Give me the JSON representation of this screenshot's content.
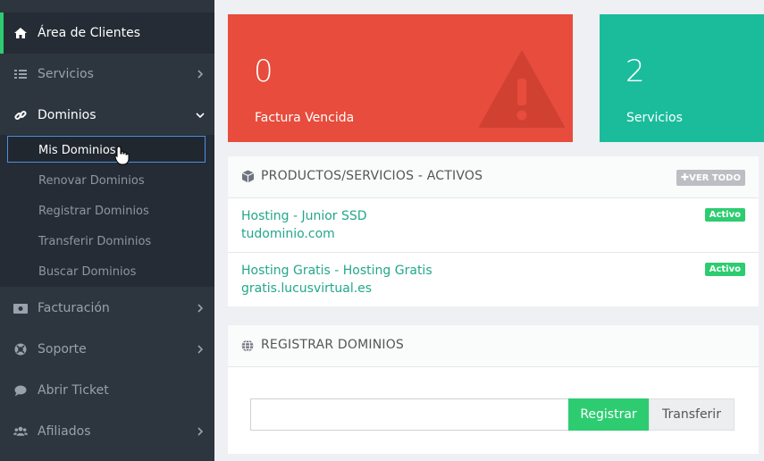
{
  "sidebar": {
    "items": [
      {
        "label": "Área de Clientes",
        "icon": "home-icon"
      },
      {
        "label": "Servicios",
        "icon": "list-icon"
      },
      {
        "label": "Dominios",
        "icon": "link-icon"
      },
      {
        "label": "Facturación",
        "icon": "money-icon"
      },
      {
        "label": "Soporte",
        "icon": "lifebuoy-icon"
      },
      {
        "label": "Abrir Ticket",
        "icon": "comment-icon"
      },
      {
        "label": "Afiliados",
        "icon": "users-icon"
      }
    ],
    "submenu": [
      {
        "label": "Mis Dominios"
      },
      {
        "label": "Renovar Dominios"
      },
      {
        "label": "Registrar Dominios"
      },
      {
        "label": "Transferir Dominios"
      },
      {
        "label": "Buscar Dominios"
      }
    ]
  },
  "stats": [
    {
      "value": "0",
      "label": "Factura Vencida",
      "color": "#e74c3c",
      "icon": "warning-icon"
    },
    {
      "value": "2",
      "label": "Servicios",
      "color": "#1abc9c"
    }
  ],
  "products_panel": {
    "title": "PRODUCTOS/SERVICIOS - ACTIVOS",
    "view_all": "VER TODO",
    "rows": [
      {
        "name": "Hosting - Junior SSD",
        "domain": "tudominio.com",
        "status": "Activo"
      },
      {
        "name": "Hosting Gratis - Hosting Gratis",
        "domain": "gratis.lucusvirtual.es",
        "status": "Activo"
      }
    ]
  },
  "domains_panel": {
    "title": "REGISTRAR DOMINIOS",
    "input_value": "",
    "register_label": "Registrar",
    "transfer_label": "Transferir"
  },
  "colors": {
    "accent": "#2ecc71",
    "link": "#23a78b",
    "sidebar": "#2d353f"
  }
}
